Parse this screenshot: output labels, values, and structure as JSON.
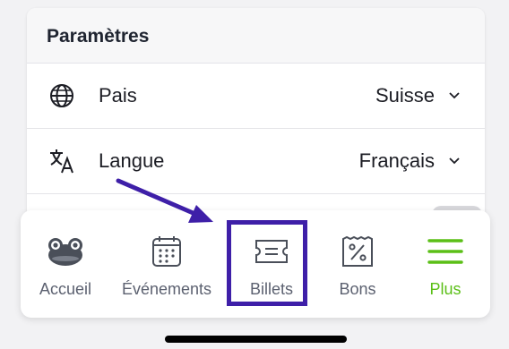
{
  "settings": {
    "title": "Paramètres",
    "rows": [
      {
        "label": "Pais",
        "value": "Suisse",
        "icon": "globe-icon"
      },
      {
        "label": "Langue",
        "value": "Français",
        "icon": "translate-icon"
      }
    ]
  },
  "nav": {
    "items": [
      {
        "label": "Accueil",
        "icon": "frog-icon",
        "active": false
      },
      {
        "label": "Événements",
        "icon": "calendar-icon",
        "active": false
      },
      {
        "label": "Billets",
        "icon": "ticket-icon",
        "active": false
      },
      {
        "label": "Bons",
        "icon": "voucher-icon",
        "active": false
      },
      {
        "label": "Plus",
        "icon": "menu-icon",
        "active": true
      }
    ]
  },
  "colors": {
    "accent": "#5bbf17",
    "highlight": "#3e1fa8",
    "text": "#1c1d24",
    "muted": "#5c6170"
  }
}
